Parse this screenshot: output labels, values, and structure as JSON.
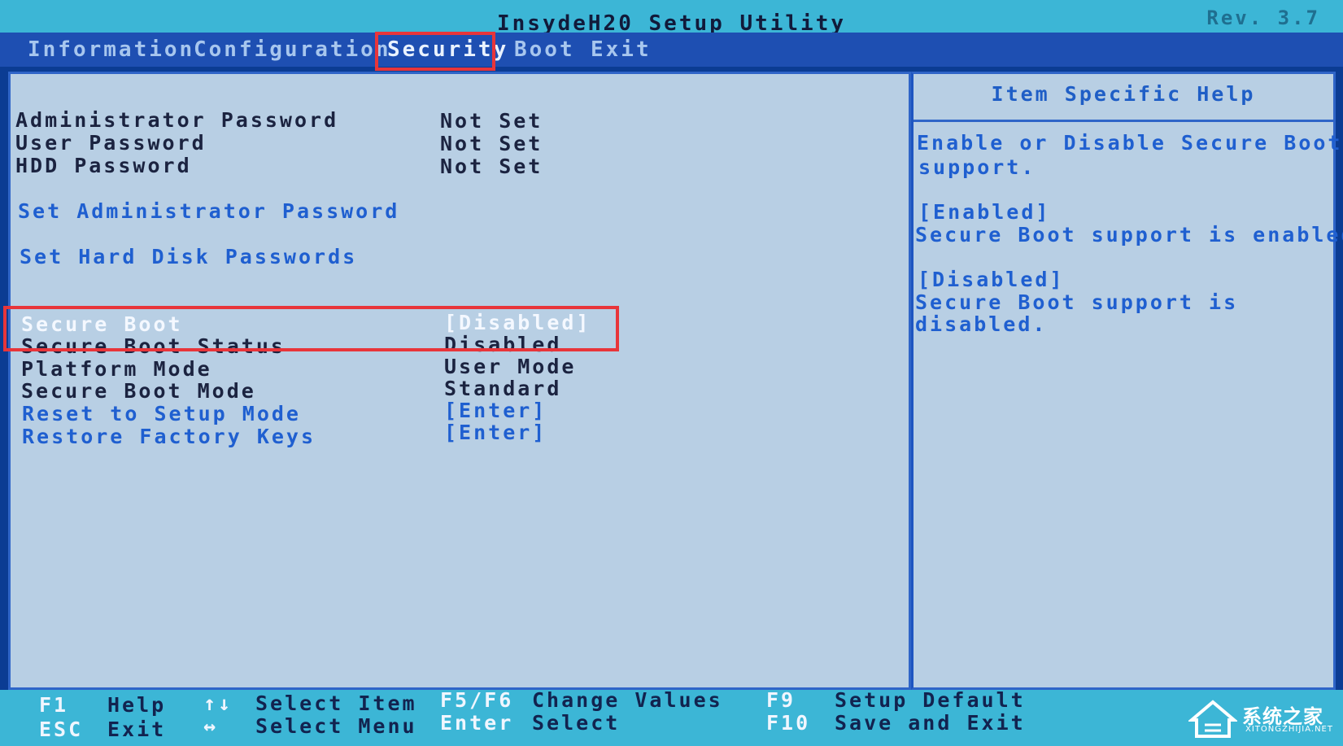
{
  "app": {
    "title": "InsydeH20 Setup Utility",
    "revision": "Rev. 3.7"
  },
  "menu": {
    "tabs": [
      {
        "label": "Information"
      },
      {
        "label": "Configuration"
      },
      {
        "label": "Security",
        "active": true
      },
      {
        "label": "Boot"
      },
      {
        "label": "Exit"
      }
    ]
  },
  "security": {
    "admin_password": {
      "label": "Administrator Password",
      "value": "Not Set"
    },
    "user_password": {
      "label": "User Password",
      "value": "Not Set"
    },
    "hdd_password": {
      "label": "HDD Password",
      "value": "Not Set"
    },
    "set_admin_password": {
      "label": "Set Administrator Password"
    },
    "set_hdd_passwords": {
      "label": "Set Hard Disk Passwords"
    },
    "secure_boot": {
      "label": "Secure Boot",
      "value": "[Disabled]"
    },
    "secure_boot_status": {
      "label": "Secure Boot Status",
      "value": "Disabled"
    },
    "platform_mode": {
      "label": "Platform Mode",
      "value": "User Mode"
    },
    "secure_boot_mode": {
      "label": "Secure Boot Mode",
      "value": "Standard"
    },
    "reset_setup_mode": {
      "label": "Reset to Setup Mode",
      "value": "[Enter]"
    },
    "restore_factory_keys": {
      "label": "Restore Factory Keys",
      "value": "[Enter]"
    }
  },
  "help": {
    "title": "Item Specific Help",
    "lines": [
      "Enable or Disable Secure Boot",
      "support.",
      "[Enabled]",
      "Secure Boot support is enabled.",
      "[Disabled]",
      "Secure Boot support is",
      "disabled."
    ]
  },
  "footer": {
    "f1_key": "F1",
    "f1_desc": "Help",
    "esc_key": "ESC",
    "esc_desc": "Exit",
    "updown_key": "↑↓",
    "updown_desc": "Select Item",
    "leftright_key": "↔",
    "leftright_desc": "Select Menu",
    "f5f6_key": "F5/F6",
    "f5f6_desc": "Change Values",
    "enter_key": "Enter",
    "enter_desc": "Select",
    "f9_key": "F9",
    "f9_desc": "Setup Default",
    "f10_key": "F10",
    "f10_desc": "Save and Exit"
  },
  "watermark": {
    "name": "系统之家",
    "site": "XITONGZHIJIA.NET"
  },
  "colors": {
    "title_bar": "#3cb6d6",
    "menu_bar": "#1e4fb2",
    "panel": "#b8cfe4",
    "accent_red": "#e8353a",
    "link_blue": "#1f5fd0"
  }
}
